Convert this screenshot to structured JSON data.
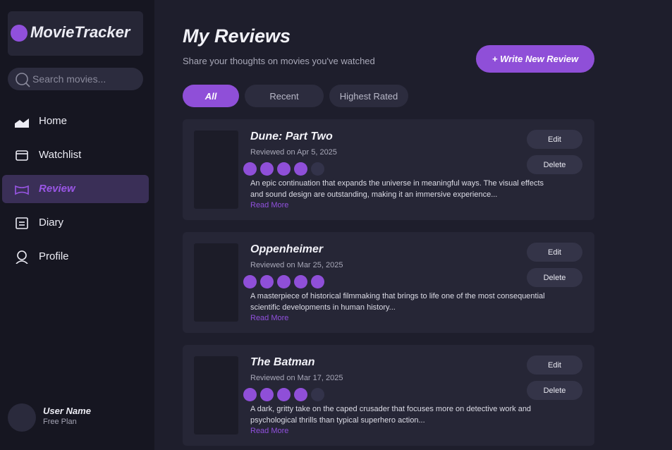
{
  "app": {
    "name": "MovieTracker",
    "accent": "#8f4fd8"
  },
  "sidebar": {
    "search_placeholder": "Search movies...",
    "items": [
      {
        "label": "Home",
        "icon": "home-icon"
      },
      {
        "label": "Watchlist",
        "icon": "watchlist-icon"
      },
      {
        "label": "Review",
        "icon": "review-icon",
        "active": true
      },
      {
        "label": "Diary",
        "icon": "diary-icon"
      },
      {
        "label": "Profile",
        "icon": "profile-icon"
      }
    ],
    "user": {
      "name": "User Name",
      "plan": "Free Plan"
    }
  },
  "main": {
    "title": "My Reviews",
    "subtitle": "Share your thoughts on movies you've watched",
    "write_button": "+ Write New Review",
    "filters": [
      {
        "label": "All",
        "active": true
      },
      {
        "label": "Recent"
      },
      {
        "label": "Highest Rated"
      }
    ],
    "reviews": [
      {
        "title": "Dune: Part Two",
        "date": "Reviewed on Apr 5, 2025",
        "rating": 4,
        "max_rating": 5,
        "excerpt": "An epic continuation that expands the universe in meaningful ways. The visual effects and sound design are outstanding, making it an immersive experience...",
        "read_more": "Read More",
        "edit": "Edit",
        "delete": "Delete"
      },
      {
        "title": "Oppenheimer",
        "date": "Reviewed on Mar 25, 2025",
        "rating": 5,
        "max_rating": 5,
        "excerpt": "A masterpiece of historical filmmaking that brings to life one of the most consequential scientific developments in human history...",
        "read_more": "Read More",
        "edit": "Edit",
        "delete": "Delete"
      },
      {
        "title": "The Batman",
        "date": "Reviewed on Mar 17, 2025",
        "rating": 4,
        "max_rating": 5,
        "excerpt": "A dark, gritty take on the caped crusader that focuses more on detective work and psychological thrills than typical superhero action...",
        "read_more": "Read More",
        "edit": "Edit",
        "delete": "Delete"
      }
    ]
  }
}
